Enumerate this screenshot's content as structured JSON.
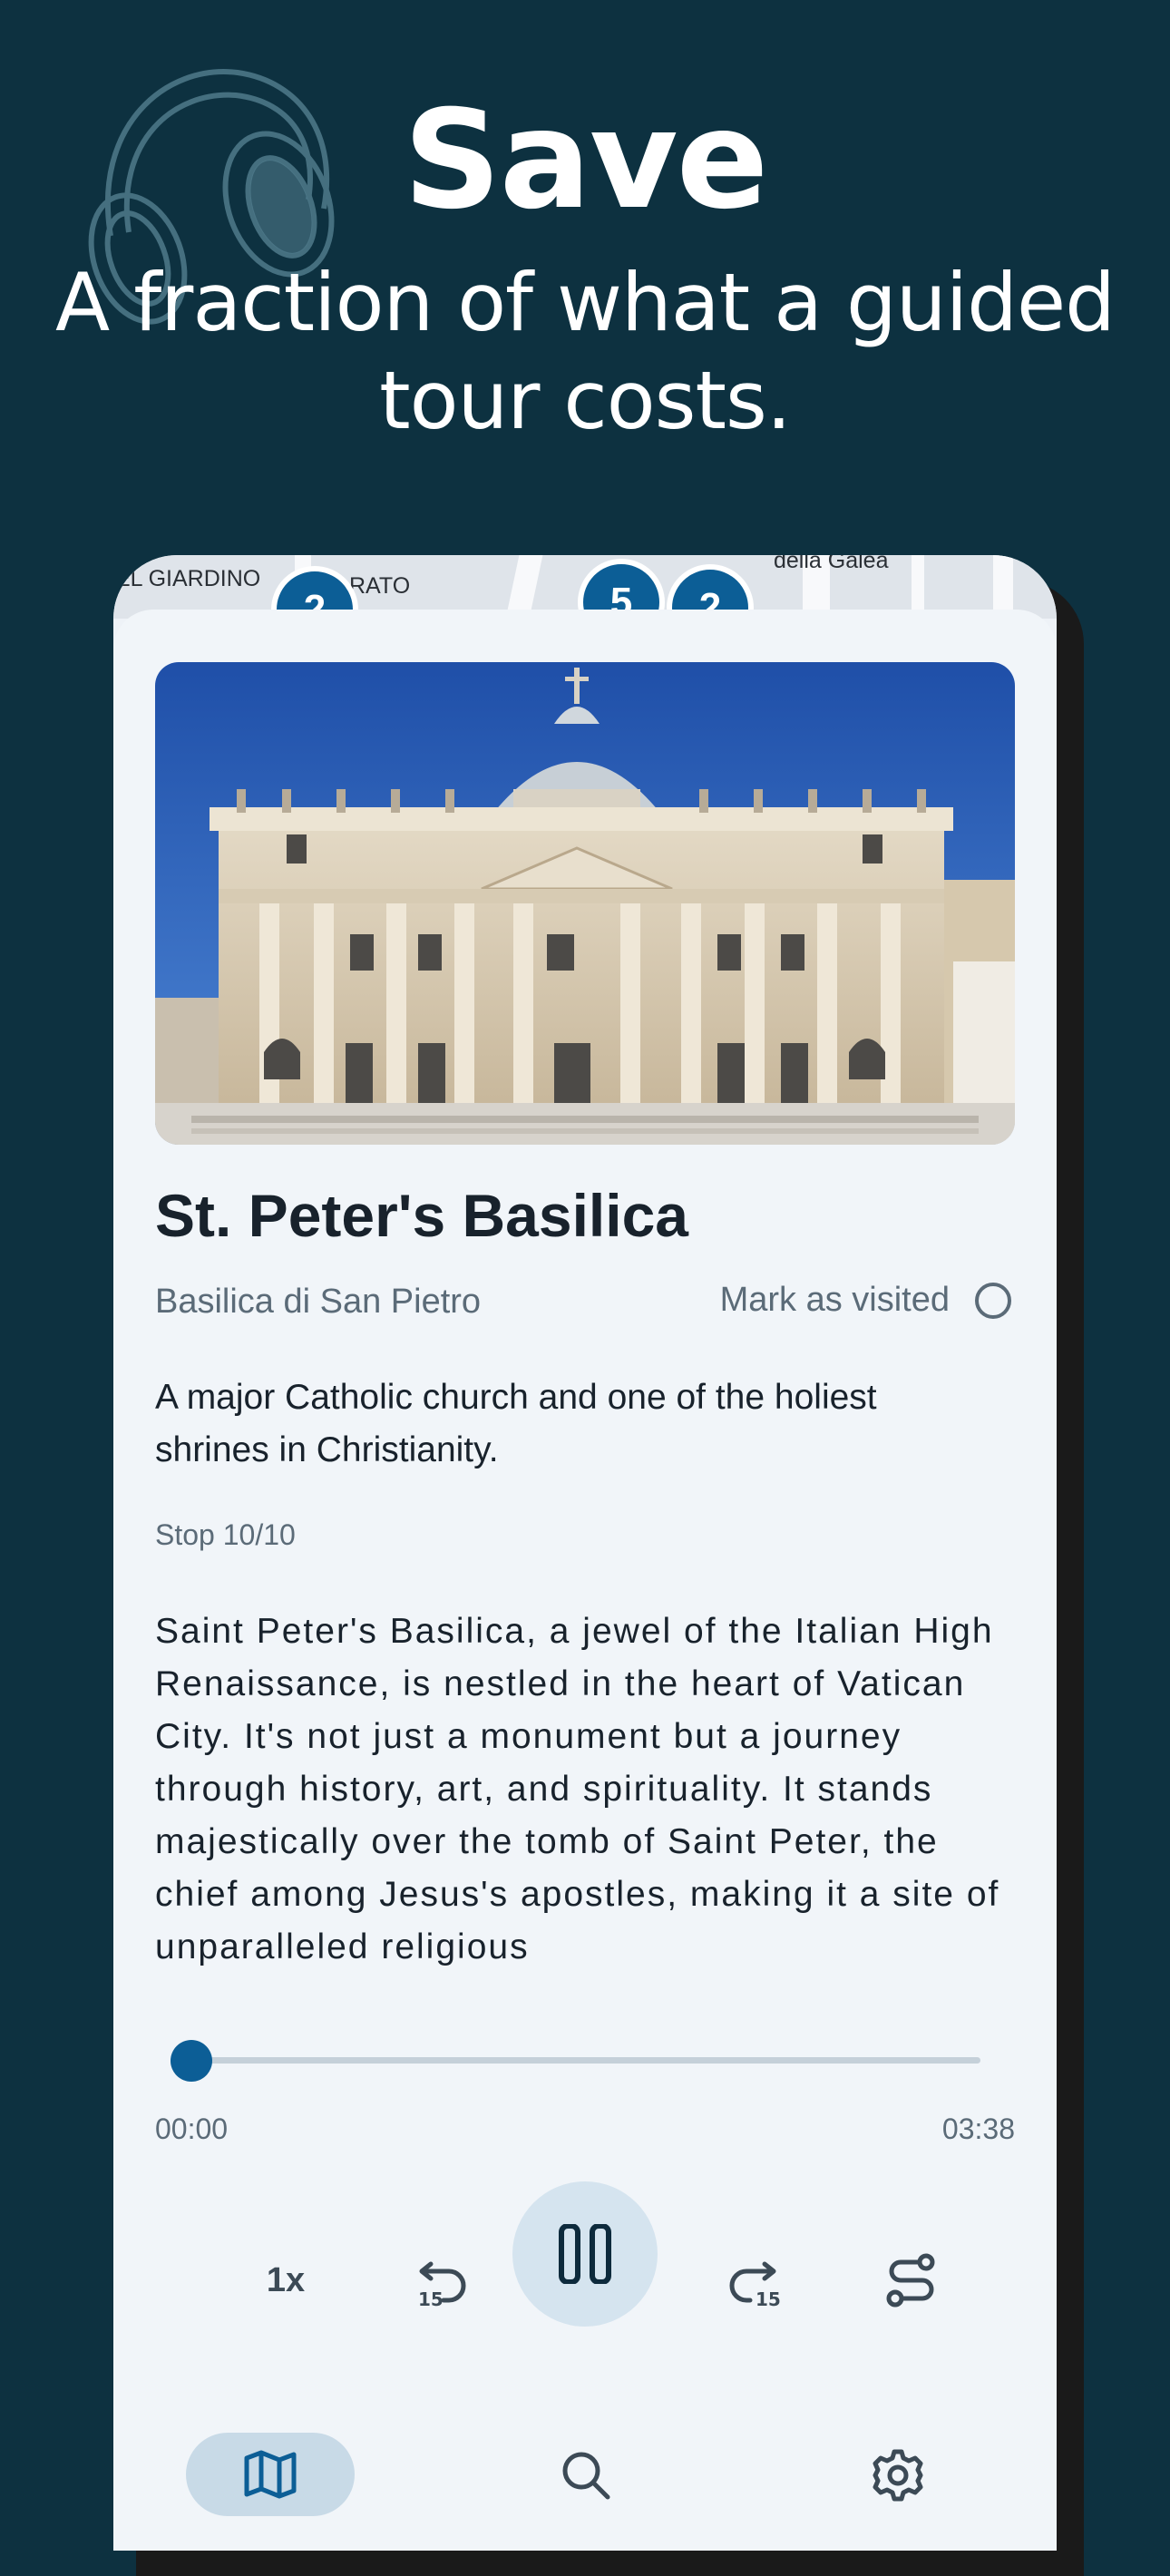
{
  "hero": {
    "title": "Save",
    "subtitle": "A fraction of what a guided tour costs.",
    "icon": "headphones-icon"
  },
  "map": {
    "labels": [
      "EL GIARDINO",
      "RATO",
      "della Galea"
    ],
    "markers": [
      "2",
      "5",
      "2"
    ]
  },
  "place": {
    "title": "St. Peter's Basilica",
    "local_name": "Basilica di San Pietro",
    "mark_visited_label": "Mark as visited",
    "summary": "A major Catholic church and one of the holiest shrines in Christianity.",
    "stop": "Stop 10/10",
    "description": "Saint Peter's Basilica, a jewel of the Italian High Renaissance, is nestled in the heart of Vatican City. It's not just a monument but a journey through history, art, and spirituality. It stands majestically over the tomb of Saint Peter, the chief among Jesus's apostles, making it a site of unparalleled religious"
  },
  "player": {
    "elapsed": "00:00",
    "duration": "03:38",
    "progress": 0,
    "speed_label": "1x",
    "rewind_icon": "rewind-15-icon",
    "pause_icon": "pause-icon",
    "forward_icon": "forward-15-icon",
    "route_icon": "route-icon"
  },
  "nav": {
    "items": [
      "map-icon",
      "search-icon",
      "settings-icon"
    ],
    "active": "map-icon"
  },
  "colors": {
    "background": "#0d3140",
    "accent": "#0c5e96",
    "sheet": "#f1f5f9"
  }
}
